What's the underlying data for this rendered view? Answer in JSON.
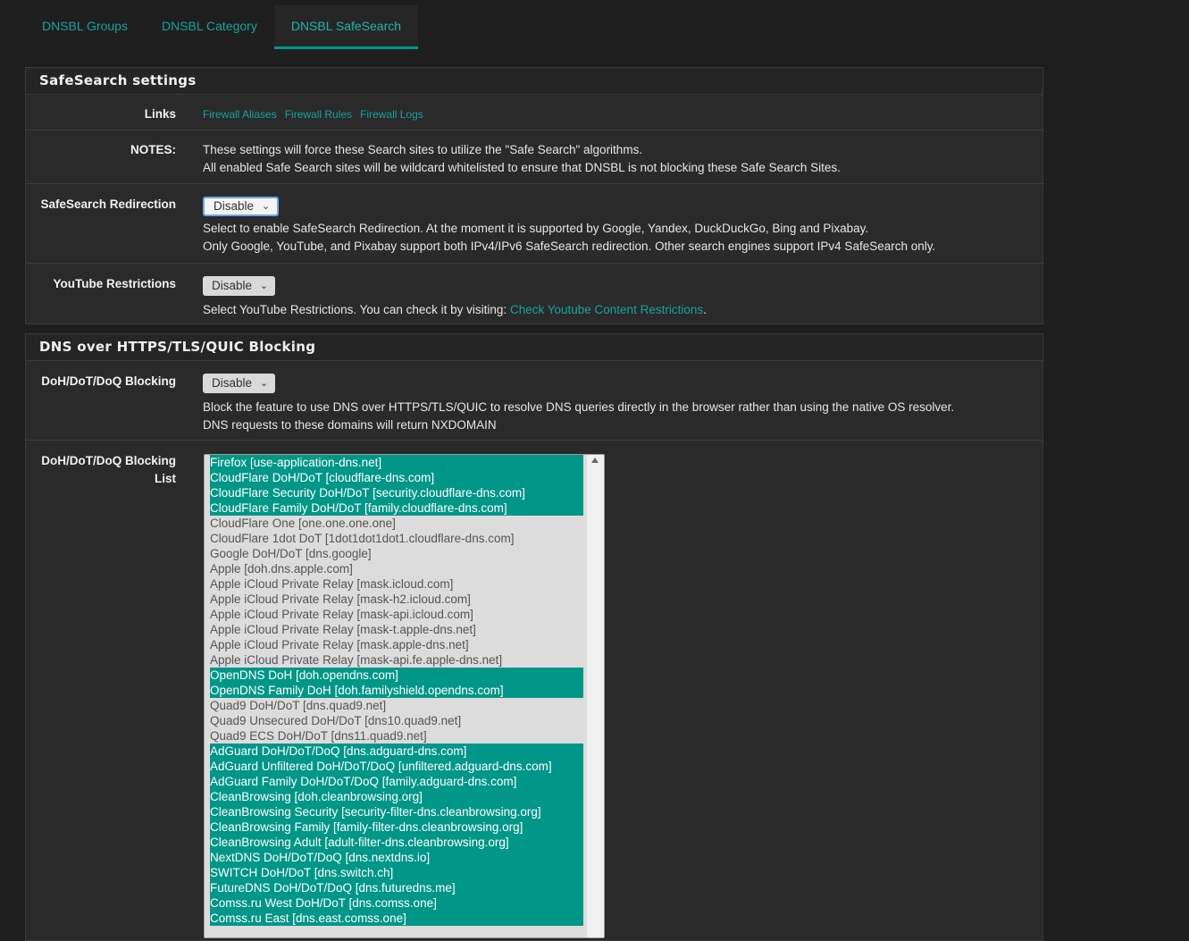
{
  "tabs": [
    {
      "label": "DNSBL Groups"
    },
    {
      "label": "DNSBL Category"
    },
    {
      "label": "DNSBL SafeSearch"
    }
  ],
  "safesearch": {
    "title": "SafeSearch settings",
    "links_label": "Links",
    "links": [
      "Firewall Aliases",
      "Firewall Rules",
      "Firewall Logs"
    ],
    "notes_label": "NOTES:",
    "notes": [
      "These settings will force these Search sites to utilize the \"Safe Search\" algorithms.",
      "All enabled Safe Search sites will be wildcard whitelisted to ensure that DNSBL is not blocking these Safe Search Sites."
    ],
    "redirect_label": "SafeSearch Redirection",
    "redirect_value": "Disable",
    "redirect_help": [
      "Select to enable SafeSearch Redirection. At the moment it is supported by Google, Yandex, DuckDuckGo, Bing and Pixabay.",
      "Only Google, YouTube, and Pixabay support both IPv4/IPv6 SafeSearch redirection. Other search engines support IPv4 SafeSearch only."
    ],
    "youtube_label": "YouTube Restrictions",
    "youtube_value": "Disable",
    "youtube_help_prefix": "Select YouTube Restrictions. You can check it by visiting: ",
    "youtube_help_link": "Check Youtube Content Restrictions",
    "youtube_help_suffix": "."
  },
  "doh": {
    "title": "DNS over HTTPS/TLS/QUIC Blocking",
    "blocking_label": "DoH/DoT/DoQ Blocking",
    "blocking_value": "Disable",
    "blocking_help": [
      "Block the feature to use DNS over HTTPS/TLS/QUIC to resolve DNS queries directly in the browser rather than using the native OS resolver.",
      "DNS requests to these domains will return NXDOMAIN"
    ],
    "list_label_1": "DoH/DoT/DoQ Blocking",
    "list_label_2": "List",
    "list": [
      {
        "text": "Firefox [use-application-dns.net]",
        "selected": true
      },
      {
        "text": "CloudFlare DoH/DoT [cloudflare-dns.com]",
        "selected": true
      },
      {
        "text": "CloudFlare Security DoH/DoT [security.cloudflare-dns.com]",
        "selected": true
      },
      {
        "text": "CloudFlare Family DoH/DoT [family.cloudflare-dns.com]",
        "selected": true
      },
      {
        "text": "CloudFlare One [one.one.one.one]",
        "selected": false
      },
      {
        "text": "CloudFlare 1dot DoT [1dot1dot1dot1.cloudflare-dns.com]",
        "selected": false
      },
      {
        "text": "Google DoH/DoT [dns.google]",
        "selected": false
      },
      {
        "text": "Apple [doh.dns.apple.com]",
        "selected": false
      },
      {
        "text": "Apple iCloud Private Relay [mask.icloud.com]",
        "selected": false
      },
      {
        "text": "Apple iCloud Private Relay [mask-h2.icloud.com]",
        "selected": false
      },
      {
        "text": "Apple iCloud Private Relay [mask-api.icloud.com]",
        "selected": false
      },
      {
        "text": "Apple iCloud Private Relay [mask-t.apple-dns.net]",
        "selected": false
      },
      {
        "text": "Apple iCloud Private Relay [mask.apple-dns.net]",
        "selected": false
      },
      {
        "text": "Apple iCloud Private Relay [mask-api.fe.apple-dns.net]",
        "selected": false
      },
      {
        "text": "OpenDNS DoH [doh.opendns.com]",
        "selected": true
      },
      {
        "text": "OpenDNS Family DoH [doh.familyshield.opendns.com]",
        "selected": true
      },
      {
        "text": "Quad9 DoH/DoT [dns.quad9.net]",
        "selected": false
      },
      {
        "text": "Quad9 Unsecured DoH/DoT [dns10.quad9.net]",
        "selected": false
      },
      {
        "text": "Quad9 ECS DoH/DoT [dns11.quad9.net]",
        "selected": false
      },
      {
        "text": "AdGuard DoH/DoT/DoQ [dns.adguard-dns.com]",
        "selected": true
      },
      {
        "text": "AdGuard Unfiltered DoH/DoT/DoQ [unfiltered.adguard-dns.com]",
        "selected": true
      },
      {
        "text": "AdGuard Family DoH/DoT/DoQ [family.adguard-dns.com]",
        "selected": true
      },
      {
        "text": "CleanBrowsing [doh.cleanbrowsing.org]",
        "selected": true
      },
      {
        "text": "CleanBrowsing Security [security-filter-dns.cleanbrowsing.org]",
        "selected": true
      },
      {
        "text": "CleanBrowsing Family [family-filter-dns.cleanbrowsing.org]",
        "selected": true
      },
      {
        "text": "CleanBrowsing Adult [adult-filter-dns.cleanbrowsing.org]",
        "selected": true
      },
      {
        "text": "NextDNS DoH/DoT/DoQ [dns.nextdns.io]",
        "selected": true
      },
      {
        "text": "SWITCH DoH/DoT [dns.switch.ch]",
        "selected": true
      },
      {
        "text": "FutureDNS DoH/DoT/DoQ [dns.futuredns.me]",
        "selected": true
      },
      {
        "text": "Comss.ru West DoH/DoT [dns.comss.one]",
        "selected": true
      },
      {
        "text": "Comss.ru East [dns.east.comss.one]",
        "selected": true
      }
    ]
  }
}
